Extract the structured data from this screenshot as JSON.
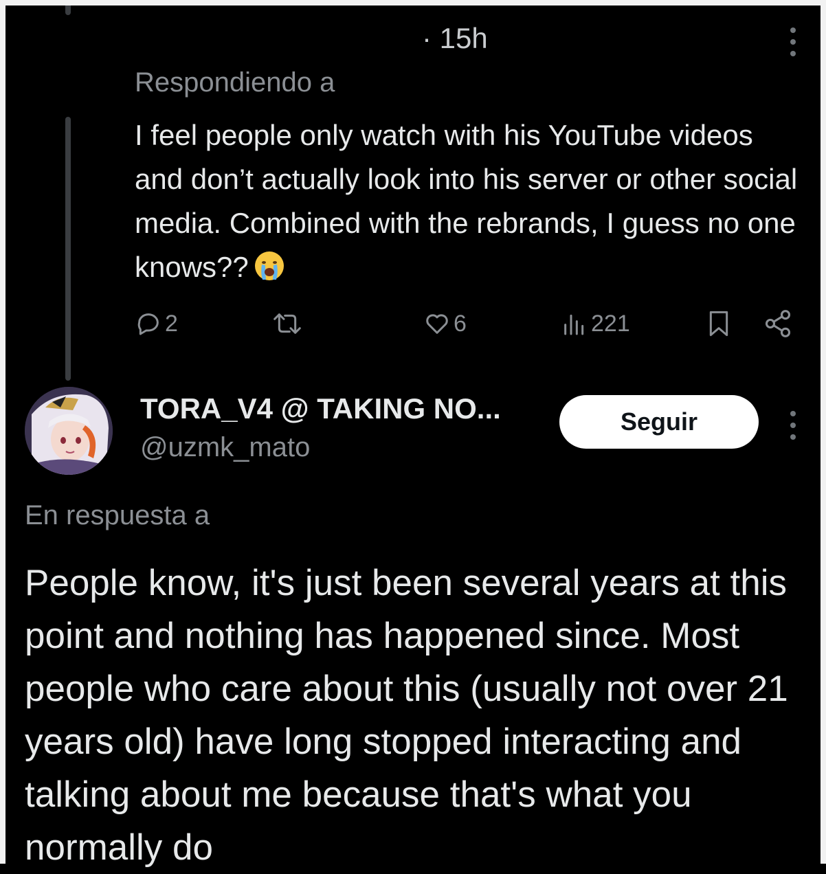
{
  "reply": {
    "time": "· 15h",
    "replying_to": "Respondiendo a",
    "text": "I feel people only watch with his YouTube videos and don’t actually look into his server or other social media. Combined with the rebrands, I guess no one knows??",
    "emoji": "loudly-crying-face",
    "actions": {
      "replies": "2",
      "retweets": "",
      "likes": "6",
      "views": "221"
    }
  },
  "main_post": {
    "display_name": "TORA_V4 @ TAKING NO...",
    "handle": "@uzmk_mato",
    "follow_label": "Seguir",
    "in_reply_to": "En respuesta a",
    "text": "People know, it's just been several years at this point and nothing has happened since. Most people who care about this (usually not over 21 years old) have long stopped interacting and talking about me because that's what you normally do"
  },
  "colors": {
    "background": "#000000",
    "text": "#e7e9ea",
    "muted": "#8b8f94",
    "button_bg": "#ffffff",
    "emoji": "#f7c640"
  }
}
